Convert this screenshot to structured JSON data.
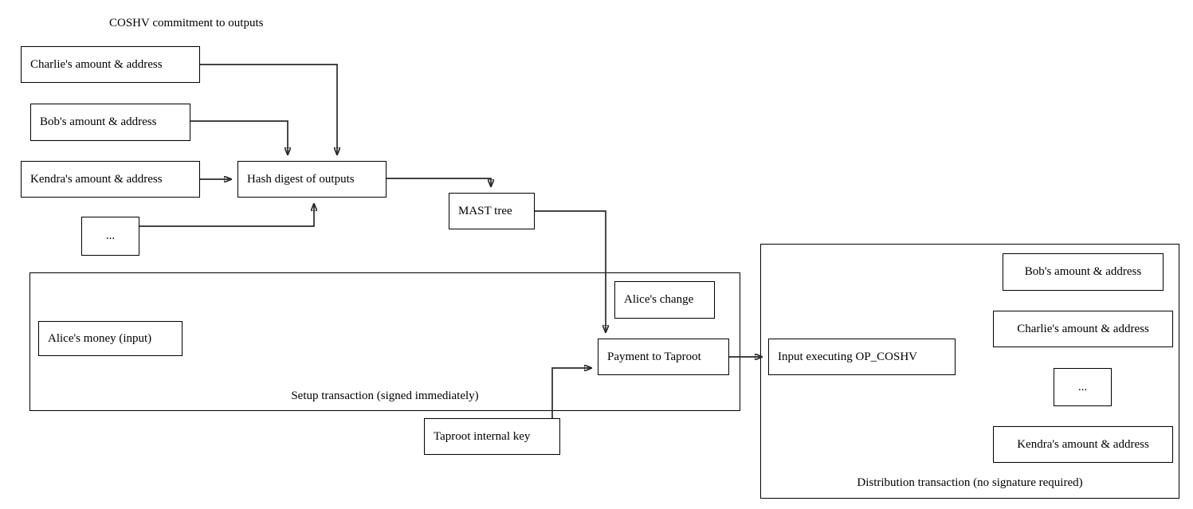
{
  "diagram": {
    "title": "COSHV commitment to outputs",
    "nodes": {
      "charlie_out": "Charlie's amount & address",
      "bob_out": "Bob's amount & address",
      "kendra_out": "Kendra's amount & address",
      "ellipsis_out": "...",
      "hash_digest": "Hash digest of outputs",
      "mast_tree": "MAST tree",
      "alice_money": "Alice's money (input)",
      "alices_change": "Alice's change",
      "payment_taproot": "Payment to Taproot",
      "taproot_key": "Taproot internal key",
      "input_coshv": "Input executing OP_COSHV",
      "dist_bob": "Bob's amount & address",
      "dist_charlie": "Charlie's amount & address",
      "dist_ellipsis": "...",
      "dist_kendra": "Kendra's amount & address"
    },
    "groups": {
      "setup_tx": "Setup transaction (signed immediately)",
      "distribution_tx": "Distribution transaction (no signature required)"
    },
    "colors": {
      "stroke": "#000000",
      "edge": "#2a2a2a",
      "background": "#ffffff",
      "text": "#000000"
    }
  }
}
